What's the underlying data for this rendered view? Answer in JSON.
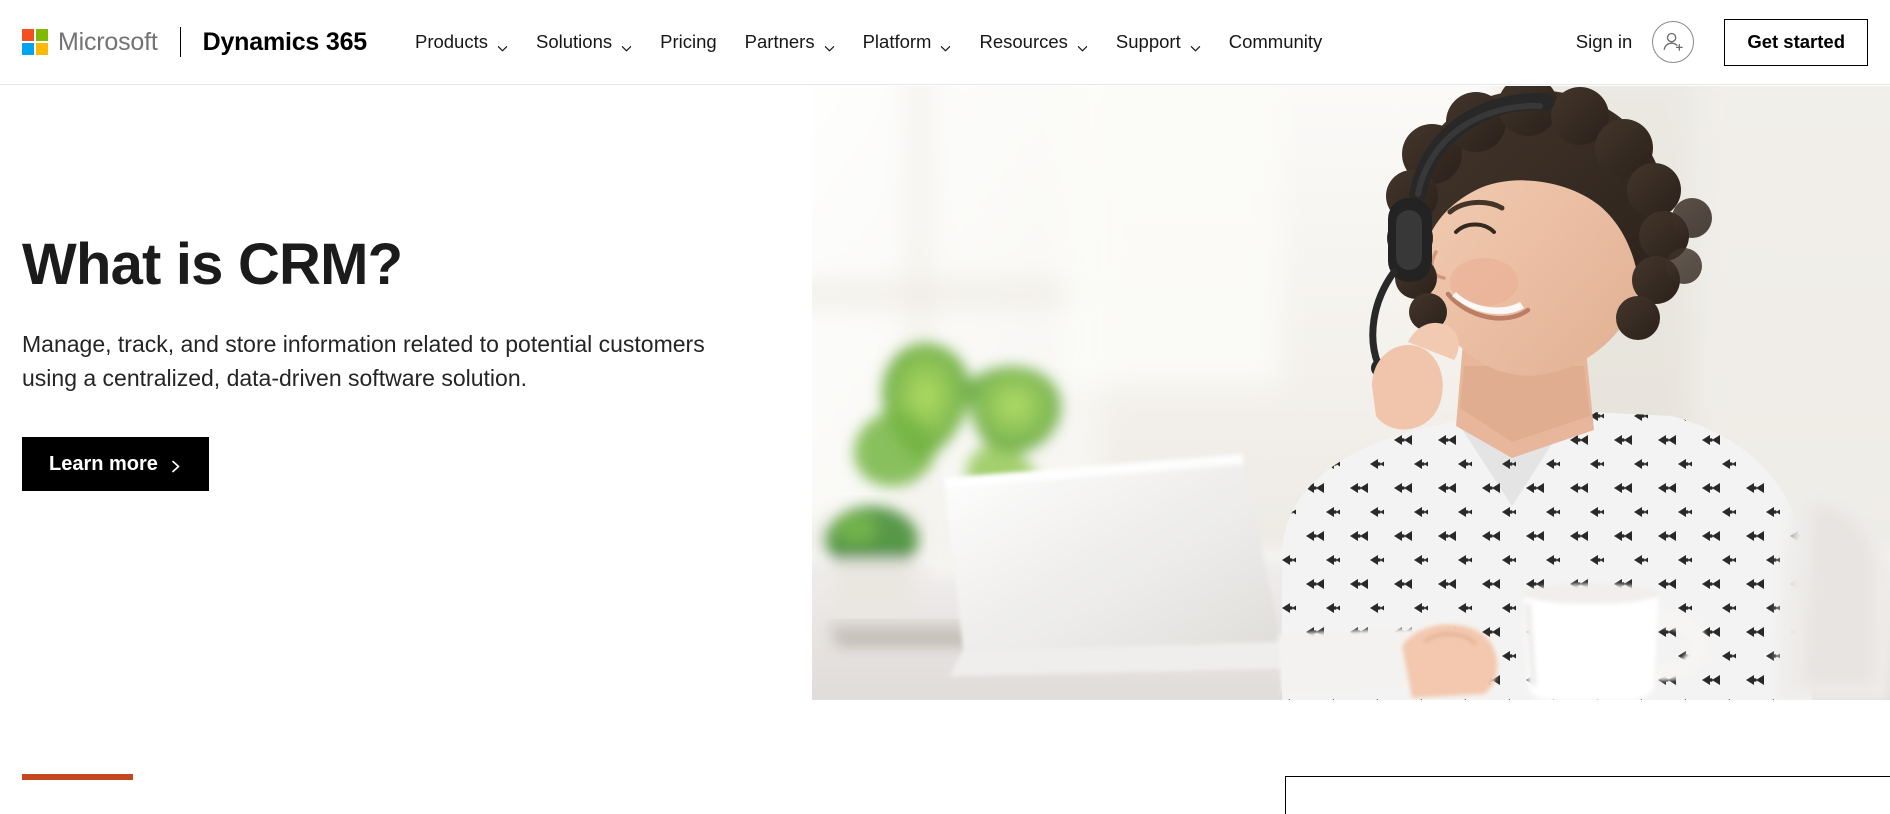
{
  "navbar": {
    "logo_icon": "microsoft-logo-icon",
    "wordmark": "Microsoft",
    "product_name": "Dynamics 365",
    "menu": [
      {
        "label": "Products",
        "has_chevron": true,
        "icon": "chevron-down-icon"
      },
      {
        "label": "Solutions",
        "has_chevron": true,
        "icon": "chevron-down-icon"
      },
      {
        "label": "Pricing",
        "has_chevron": false,
        "icon": ""
      },
      {
        "label": "Partners",
        "has_chevron": true,
        "icon": "chevron-down-icon"
      },
      {
        "label": "Platform",
        "has_chevron": true,
        "icon": "chevron-down-icon"
      },
      {
        "label": "Resources",
        "has_chevron": true,
        "icon": "chevron-down-icon"
      },
      {
        "label": "Support",
        "has_chevron": true,
        "icon": "chevron-down-icon"
      },
      {
        "label": "Community",
        "has_chevron": false,
        "icon": ""
      }
    ],
    "sign_in_label": "Sign in",
    "account_icon": "account-person-add-icon",
    "get_started_label": "Get started"
  },
  "hero": {
    "title": "What is CRM?",
    "subtitle": "Manage, track, and store information related to potential customers using a centralized, data-driven software solution.",
    "cta_label": "Learn more",
    "cta_icon": "chevron-right-icon",
    "image_alt": "Person wearing a headset smiling while using a laptop at a bright desk with a plant and a coffee mug"
  },
  "below_fold": {
    "accent_bar_name": "section-accent-bar",
    "card_name": "content-card-peek"
  },
  "colors": {
    "logo_red": "#F25022",
    "logo_green": "#7FBA00",
    "logo_blue": "#00A4EF",
    "logo_yellow": "#FFB900",
    "accent_orange": "#C4471F",
    "cta_background": "#000000",
    "text_primary": "#1B1B1B",
    "text_secondary": "#242424",
    "wordmark_gray": "#737373",
    "nav_border": "#E6E6E6"
  }
}
